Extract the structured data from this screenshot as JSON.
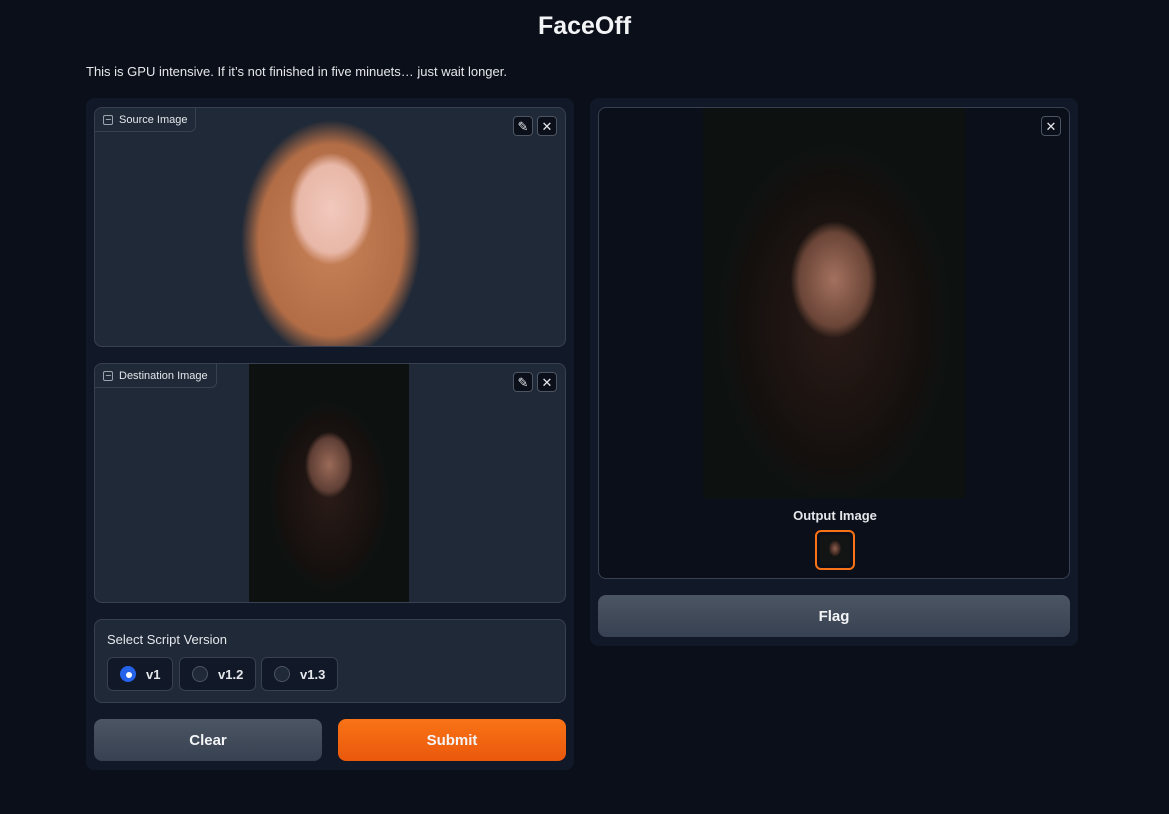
{
  "header": {
    "title": "FaceOff",
    "description": "This is GPU intensive. If it’s not finished in five minuets… just wait longer."
  },
  "source_image": {
    "label": "Source Image"
  },
  "destination_image": {
    "label": "Destination Image"
  },
  "output_image": {
    "label": "Output Image"
  },
  "script_version": {
    "label": "Select Script Version",
    "options": [
      "v1",
      "v1.2",
      "v1.3"
    ],
    "selected": "v1"
  },
  "buttons": {
    "clear": "Clear",
    "submit": "Submit",
    "flag": "Flag"
  },
  "icons": {
    "edit": "✎",
    "close": "✕"
  },
  "colors": {
    "accent": "#f97316",
    "radio_selected": "#2563eb",
    "background": "#0b0f19"
  }
}
